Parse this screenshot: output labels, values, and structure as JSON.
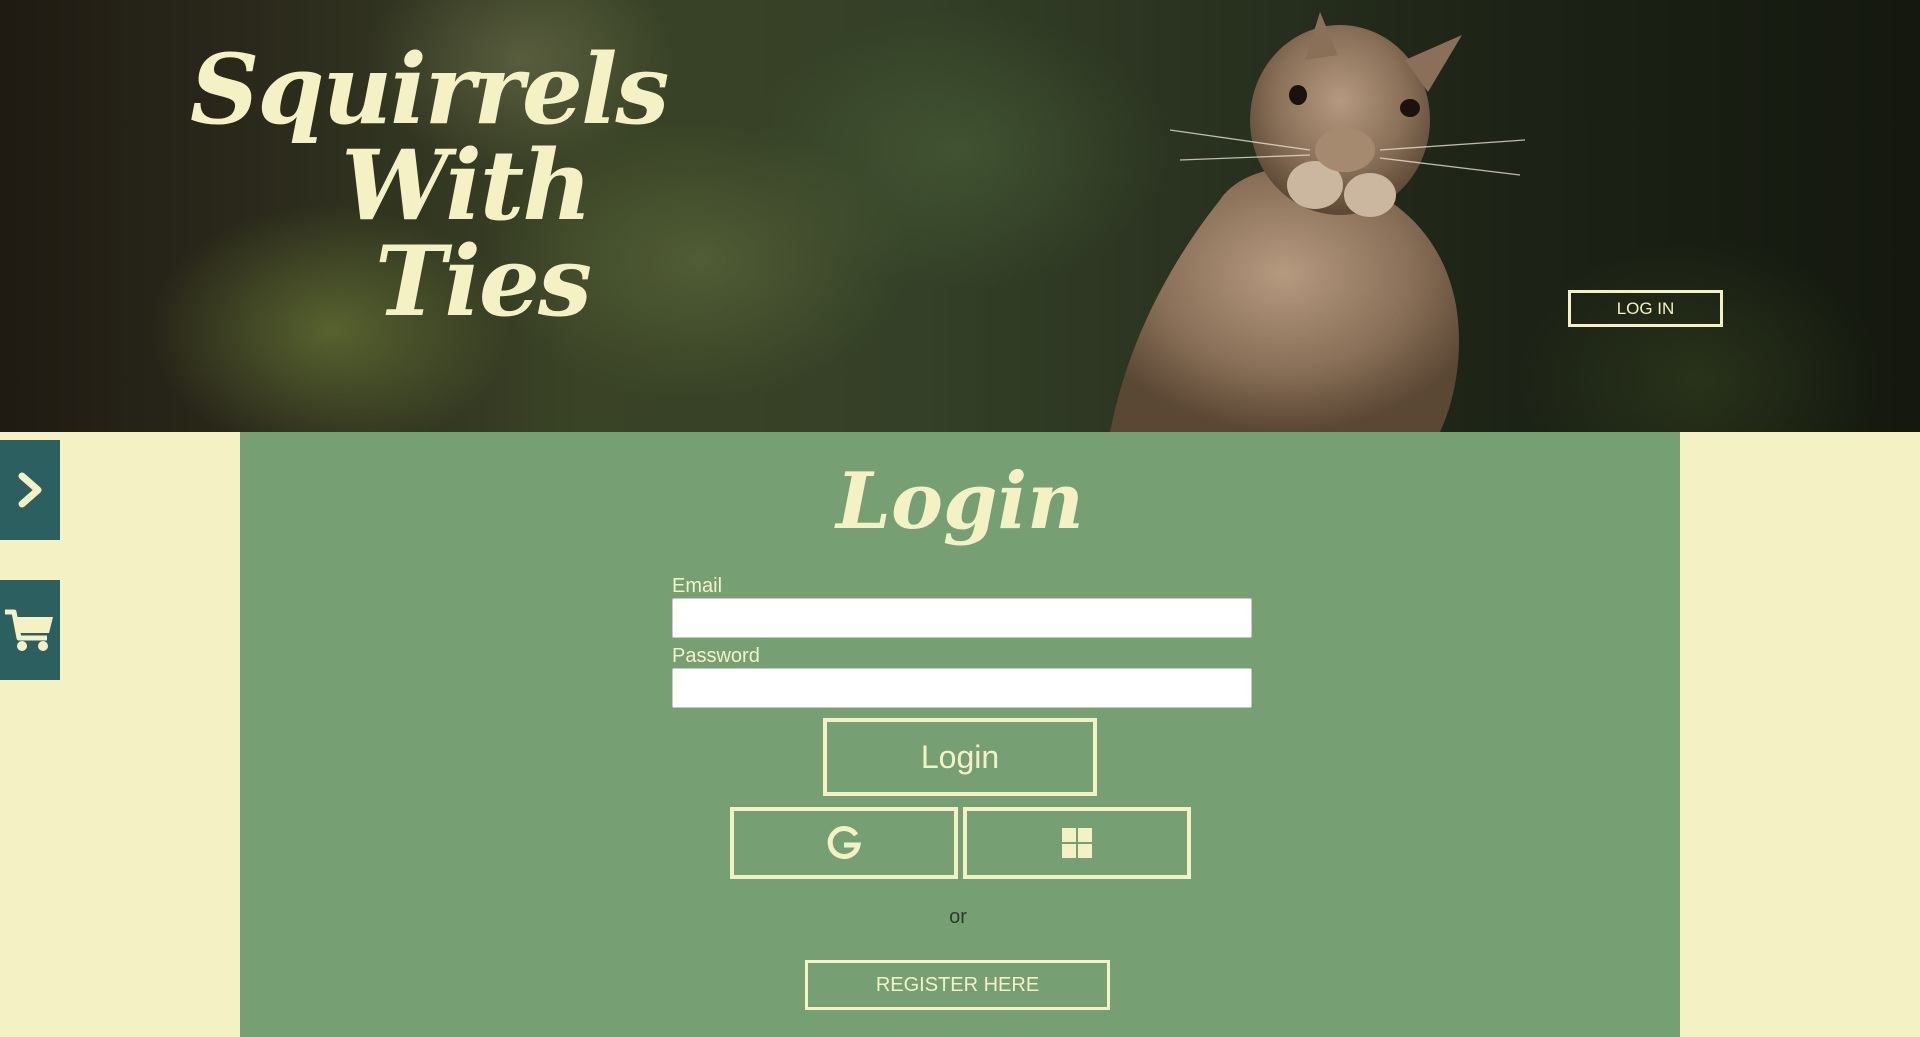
{
  "site": {
    "title_lines": [
      "Squirrels",
      "With",
      "Ties"
    ]
  },
  "header": {
    "login_link": "LOG IN"
  },
  "sidebar": {
    "items": [
      {
        "icon": "chevron-right-icon"
      },
      {
        "icon": "cart-icon"
      }
    ]
  },
  "login": {
    "title": "Login",
    "email_label": "Email",
    "email_value": "",
    "password_label": "Password",
    "password_value": "",
    "submit_label": "Login",
    "oauth": [
      {
        "icon": "google-icon"
      },
      {
        "icon": "windows-icon"
      }
    ],
    "separator": "or",
    "register_label": "REGISTER HERE"
  },
  "colors": {
    "accent": "#f4f2c4",
    "panel": "#76a073",
    "sidebar": "#2c5f5f"
  }
}
